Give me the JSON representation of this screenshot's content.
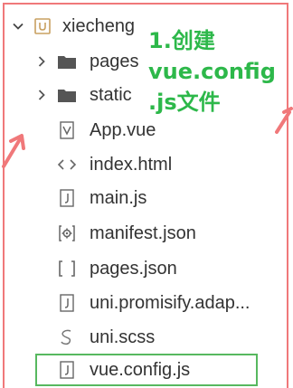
{
  "tree": {
    "root": {
      "label": "xiecheng",
      "icon": "project-folder-icon"
    },
    "items": [
      {
        "label": "pages",
        "icon": "folder-icon",
        "expandable": true
      },
      {
        "label": "static",
        "icon": "folder-icon",
        "expandable": true
      },
      {
        "label": "App.vue",
        "icon": "vue-file-icon"
      },
      {
        "label": "index.html",
        "icon": "html-code-icon"
      },
      {
        "label": "main.js",
        "icon": "js-file-icon"
      },
      {
        "label": "manifest.json",
        "icon": "manifest-file-icon"
      },
      {
        "label": "pages.json",
        "icon": "json-brackets-icon"
      },
      {
        "label": "uni.promisify.adap...",
        "icon": "js-file-icon"
      },
      {
        "label": "uni.scss",
        "icon": "scss-file-icon"
      },
      {
        "label": "vue.config.js",
        "icon": "js-file-icon",
        "highlighted": true
      }
    ]
  },
  "annotation": {
    "lines": [
      "1.创建",
      "vue.config",
      ".js文件"
    ],
    "color": "#2db84a"
  },
  "colors": {
    "frame": "#f0787a",
    "highlight": "#57b85f",
    "folder": "#555555",
    "project": "#c8a060"
  }
}
